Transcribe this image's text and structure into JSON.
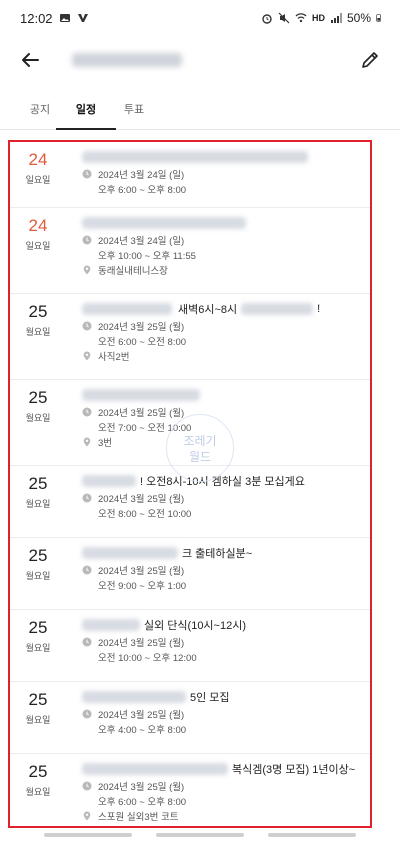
{
  "status_bar": {
    "time": "12:02",
    "battery": "50%",
    "network": "HD"
  },
  "tabs": [
    {
      "label": "공지"
    },
    {
      "label": "일정"
    },
    {
      "label": "투표"
    }
  ],
  "rows": [
    {
      "day": "24",
      "weekday": "일요일",
      "sunday": true,
      "title": "",
      "date": "2024년 3월 24일 (일)",
      "time": "오후 6:00 ~ 오후 8:00",
      "location": ""
    },
    {
      "day": "24",
      "weekday": "일요일",
      "sunday": true,
      "title": "",
      "date": "2024년 3월 24일 (일)",
      "time": "오후 10:00 ~ 오후 11:55",
      "location": "동래실내테니스장"
    },
    {
      "day": "25",
      "weekday": "월요일",
      "sunday": false,
      "title": "새벽6시~8시",
      "title_suffix": "!",
      "date": "2024년 3월 25일 (월)",
      "time": "오전 6:00 ~ 오전 8:00",
      "location": "사직2번"
    },
    {
      "day": "25",
      "weekday": "월요일",
      "sunday": false,
      "title": "",
      "date": "2024년 3월 25일 (월)",
      "time": "오전 7:00 ~ 오전 10:00",
      "location": "3번"
    },
    {
      "day": "25",
      "weekday": "월요일",
      "sunday": false,
      "title": "! 오전8시-10시 겜하실 3분 모십게요",
      "date": "2024년 3월 25일 (월)",
      "time": "오전 8:00 ~ 오전 10:00",
      "location": ""
    },
    {
      "day": "25",
      "weekday": "월요일",
      "sunday": false,
      "title": "크 출테하실분~",
      "date": "2024년 3월 25일 (월)",
      "time": "오전 9:00 ~ 오후 1:00",
      "location": ""
    },
    {
      "day": "25",
      "weekday": "월요일",
      "sunday": false,
      "title": "실외 단식(10시~12시)",
      "date": "2024년 3월 25일 (월)",
      "time": "오전 10:00 ~ 오후 12:00",
      "location": ""
    },
    {
      "day": "25",
      "weekday": "월요일",
      "sunday": false,
      "title": "5인 모집",
      "date": "2024년 3월 25일 (월)",
      "time": "오후 4:00 ~ 오후 8:00",
      "location": ""
    },
    {
      "day": "25",
      "weekday": "월요일",
      "sunday": false,
      "title": "복식겜(3명 모집) 1년이상~",
      "date": "2024년 3월 25일 (월)",
      "time": "오후 6:00 ~ 오후 8:00",
      "location": "스포원 실외3번 코트"
    }
  ],
  "watermark": {
    "line1": "조레기",
    "line2": "월드"
  }
}
